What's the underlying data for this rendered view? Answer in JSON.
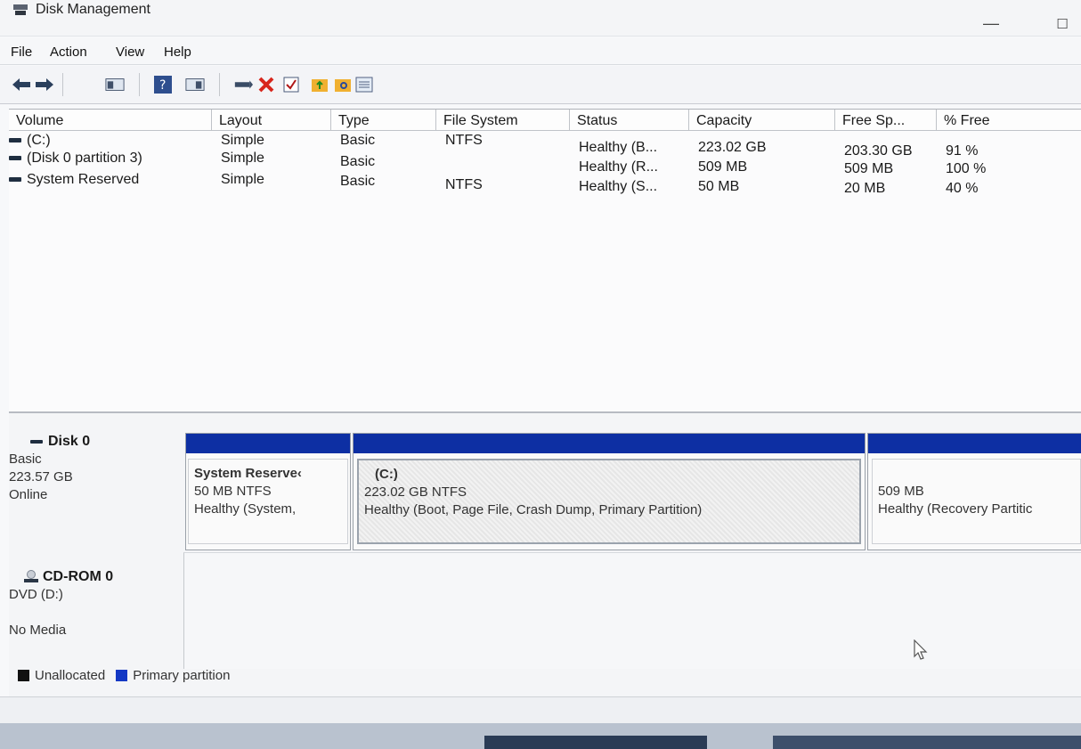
{
  "window": {
    "title": "Disk Management"
  },
  "menu": [
    "File",
    "Action",
    "View",
    "Help"
  ],
  "toolbar": {
    "icons": [
      "back-arrow-icon",
      "forward-arrow-icon",
      "console-tree-icon",
      "help-icon",
      "show-pane-icon",
      "connect-icon",
      "delete-icon",
      "properties-check-icon",
      "open-folder-icon",
      "search-folder-icon",
      "details-list-icon"
    ]
  },
  "volume_table": {
    "columns": [
      "Volume",
      "Layout",
      "Type",
      "File System",
      "Status",
      "Capacity",
      "Free Sp...",
      "% Free"
    ],
    "rows": [
      {
        "volume": "(C:)",
        "layout": "Simple",
        "type": "Basic",
        "fs": "NTFS",
        "status": "Healthy (B...",
        "capacity": "223.02 GB",
        "free": "203.30 GB",
        "pct": "91 %"
      },
      {
        "volume": "(Disk 0 partition 3)",
        "layout": "Simple",
        "type": "Basic",
        "fs": "",
        "status": "Healthy (R...",
        "capacity": "509 MB",
        "free": "509 MB",
        "pct": "100 %"
      },
      {
        "volume": "System Reserved",
        "layout": "Simple",
        "type": "Basic",
        "fs": "NTFS",
        "status": "Healthy (S...",
        "capacity": "50 MB",
        "free": "20 MB",
        "pct": "40 %"
      }
    ]
  },
  "disks": [
    {
      "name": "Disk 0",
      "type": "Basic",
      "size": "223.57 GB",
      "state": "Online",
      "partitions": [
        {
          "title": "System Reserve‹",
          "line1": "50 MB NTFS",
          "line2": "Healthy (System,"
        },
        {
          "title": "(C:)",
          "line1": "223.02 GB NTFS",
          "line2": "Healthy (Boot, Page File, Crash Dump, Primary Partition)"
        },
        {
          "title": "",
          "line1": "509 MB",
          "line2": "Healthy (Recovery Partitic"
        }
      ]
    },
    {
      "name": "CD-ROM 0",
      "type": "DVD (D:)",
      "state": "No Media"
    }
  ],
  "legend": [
    {
      "label": "Unallocated",
      "color": "#111111"
    },
    {
      "label": "Primary partition",
      "color": "#1338c4"
    }
  ],
  "colors": {
    "partition_bar": "#0d2fa3"
  }
}
